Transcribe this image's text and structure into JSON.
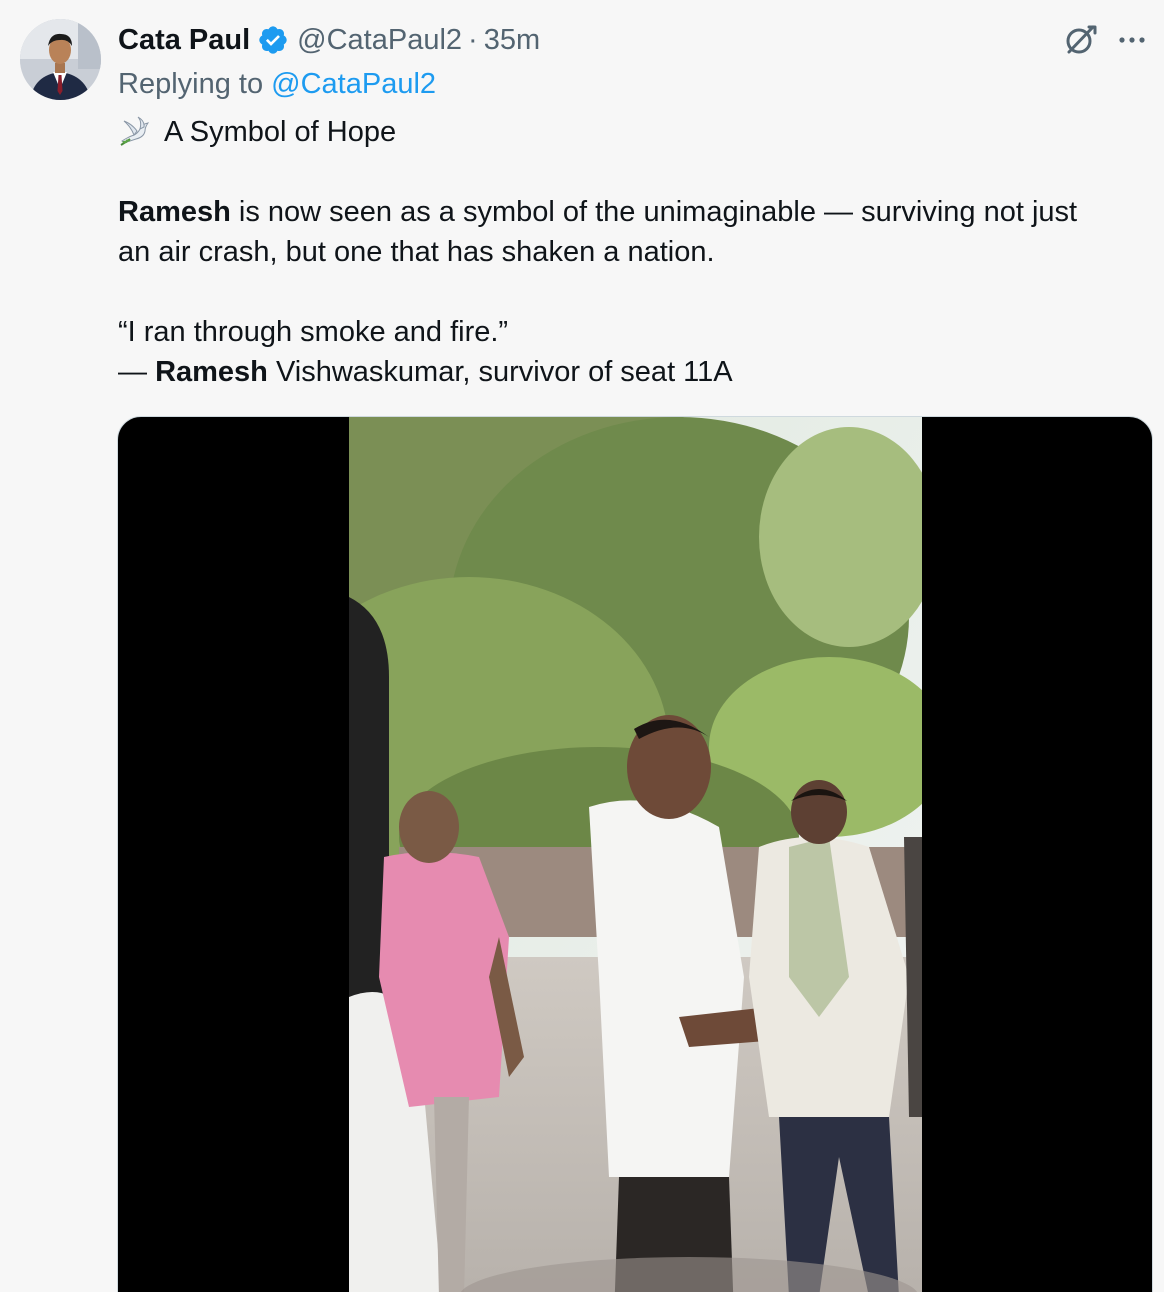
{
  "author": {
    "name": "Cata Paul",
    "handle": "@CataPaul2",
    "separator": "·",
    "time": "35m",
    "verified": true,
    "verified_color": "#1d9bf0"
  },
  "reply": {
    "prefix": "Replying to",
    "target": "@CataPaul2"
  },
  "tweet": {
    "headline_emoji": "dove-icon",
    "headline": "A Symbol of Hope",
    "p1_bold": "Ramesh",
    "p1_line1_rest": " is now seen as a symbol of the unimaginable — surviving not just",
    "p1_line2": "an air crash, but one that has shaken a nation.",
    "quote": "“I ran through smoke and fire.”",
    "attrib_prefix": "— ",
    "attrib_bold": "Ramesh",
    "attrib_rest": " Vishwaskumar, survivor of seat 11A"
  },
  "actions": {
    "grok": "grok-icon",
    "more": "more-options-icon"
  },
  "media": {
    "type": "video",
    "description_icon": "video-player"
  },
  "colors": {
    "background": "#f7f7f7",
    "text": "#0f1419",
    "secondary": "#536471",
    "link": "#1d9bf0"
  }
}
